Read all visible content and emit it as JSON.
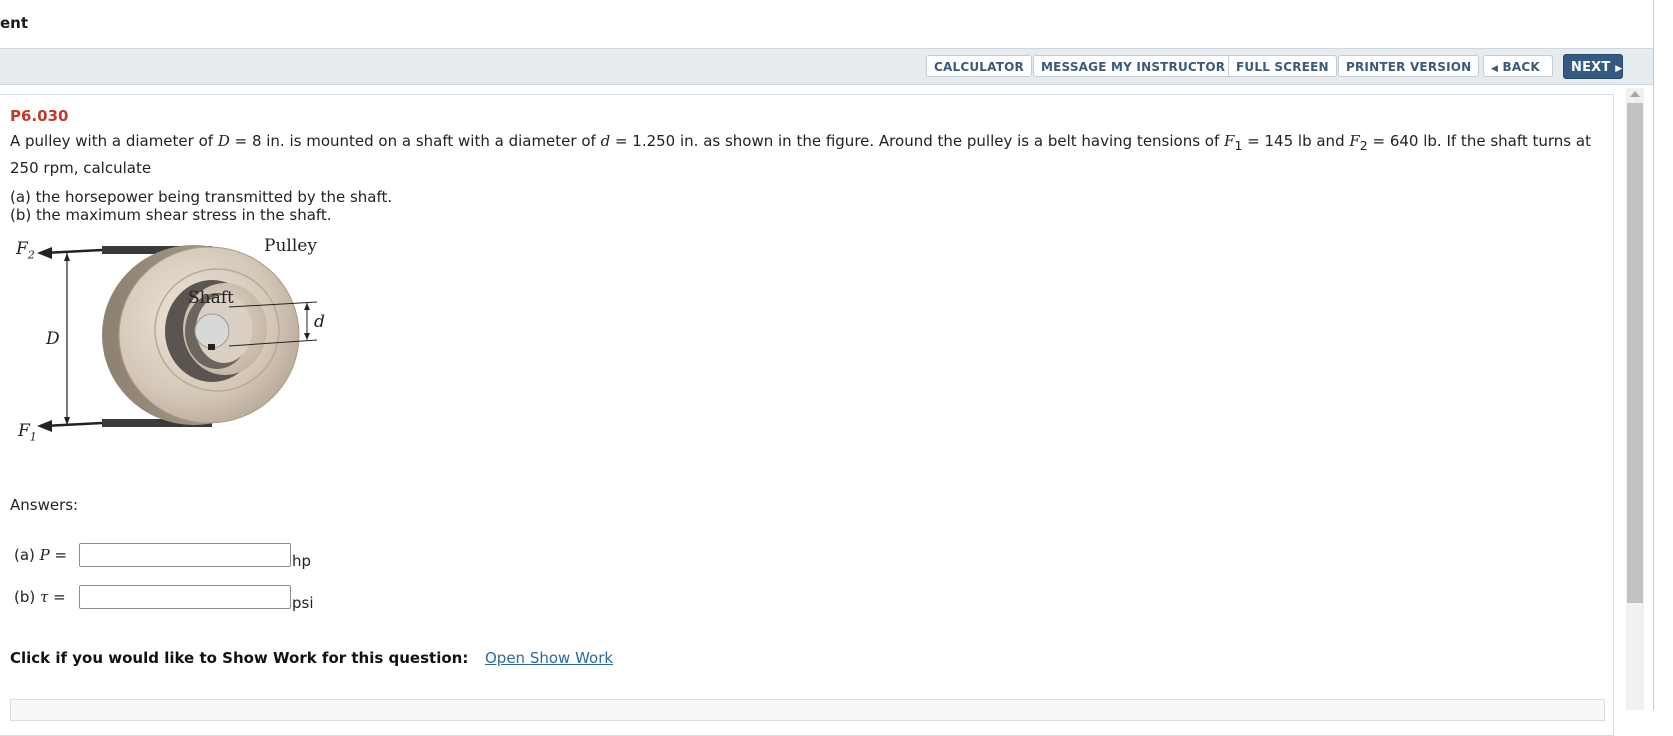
{
  "page": {
    "title": "ent"
  },
  "toolbar": {
    "calculator": "CALCULATOR",
    "message_instructor": "MESSAGE MY INSTRUCTOR",
    "full_screen": "FULL SCREEN",
    "printer_version": "PRINTER VERSION",
    "back": "BACK",
    "next": "NEXT"
  },
  "problem": {
    "id": "P6.030",
    "text_1": "A pulley with a diameter of ",
    "D": "D",
    "text_2": " = 8 in. is mounted on a shaft with a diameter of ",
    "d": "d",
    "text_3": " = 1.250 in. as shown in the figure. Around the pulley is a belt having tensions of ",
    "F": "F",
    "sub1": "1",
    "text_4": " = 145 lb and ",
    "sub2": "2",
    "text_5": " = 640 lb. If the shaft turns at 250 rpm, calculate",
    "part_a": "(a) the horsepower being transmitted by the shaft.",
    "part_b": "(b) the maximum shear stress in the shaft."
  },
  "figure": {
    "pulley_label": "Pulley",
    "shaft_label": "Shaft",
    "d_label": "d",
    "D_label": "D",
    "F": "F",
    "sub1": "1",
    "sub2": "2"
  },
  "answers": {
    "label": "Answers:",
    "a_prefix": "(a) ",
    "a_var": "P",
    "b_prefix": "(b) ",
    "b_var": "τ",
    "equals": " =",
    "a_unit": "hp",
    "b_unit": "psi",
    "a_value": "",
    "b_value": ""
  },
  "show_work": {
    "prompt": "Click if you would like to Show Work for this question:",
    "link": "Open Show Work"
  },
  "colors": {
    "problem_id": "#c0392b",
    "toolbar_bg": "#e6ebef",
    "button_text": "#3a5a7c",
    "next_bg": "#345a82",
    "link": "#2b6aa0"
  }
}
